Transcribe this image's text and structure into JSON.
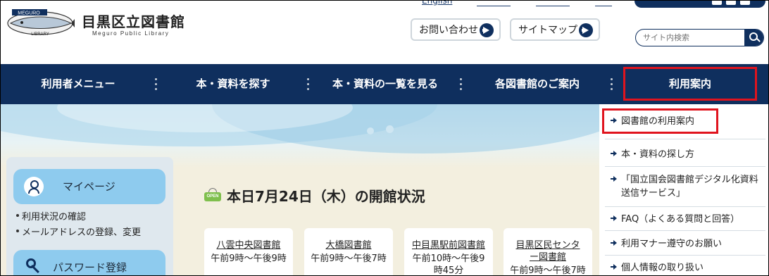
{
  "header": {
    "logo_title": "目黒区立図書館",
    "logo_sub": "Meguro Public Library",
    "logo_badge_top": "MEGURO",
    "logo_badge_bottom": "LIBRARY",
    "contact_label": "お問い合わせ",
    "sitemap_label": "サイトマップ",
    "search_placeholder": "サイト内検索"
  },
  "nav": {
    "items": [
      {
        "label": "利用者メニュー"
      },
      {
        "label": "本・資料を探す"
      },
      {
        "label": "本・資料の一覧を見る"
      },
      {
        "label": "各図書館のご案内"
      },
      {
        "label": "利用案内"
      }
    ]
  },
  "dropdown": {
    "items": [
      {
        "label": "図書館の利用案内"
      },
      {
        "label": "本・資料の探し方"
      },
      {
        "label": "「国立国会図書館デジタル化資料送信サービス」"
      },
      {
        "label": "FAQ（よくある質問と回答）"
      },
      {
        "label": "利用マナー遵守のお願い"
      },
      {
        "label": "個人情報の取り扱い"
      }
    ]
  },
  "sidebar": {
    "mypage_label": "マイページ",
    "links": [
      "利用状況の確認",
      "メールアドレスの登録、変更"
    ],
    "password_label": "パスワード登録"
  },
  "status": {
    "open_sign": "OPEN",
    "title": "本日7月24日（木）の開館状況",
    "libraries": [
      {
        "name": "八雲中央図書館",
        "hours": "午前9時～午後9時"
      },
      {
        "name": "大橋図書館",
        "hours": "午前9時～午後7時"
      },
      {
        "name": "中目黒駅前図書館",
        "hours": "午前10時～午後9時45分"
      },
      {
        "name": "目黒区民センター図書館",
        "hours": "午前9時～午後7時"
      }
    ]
  }
}
